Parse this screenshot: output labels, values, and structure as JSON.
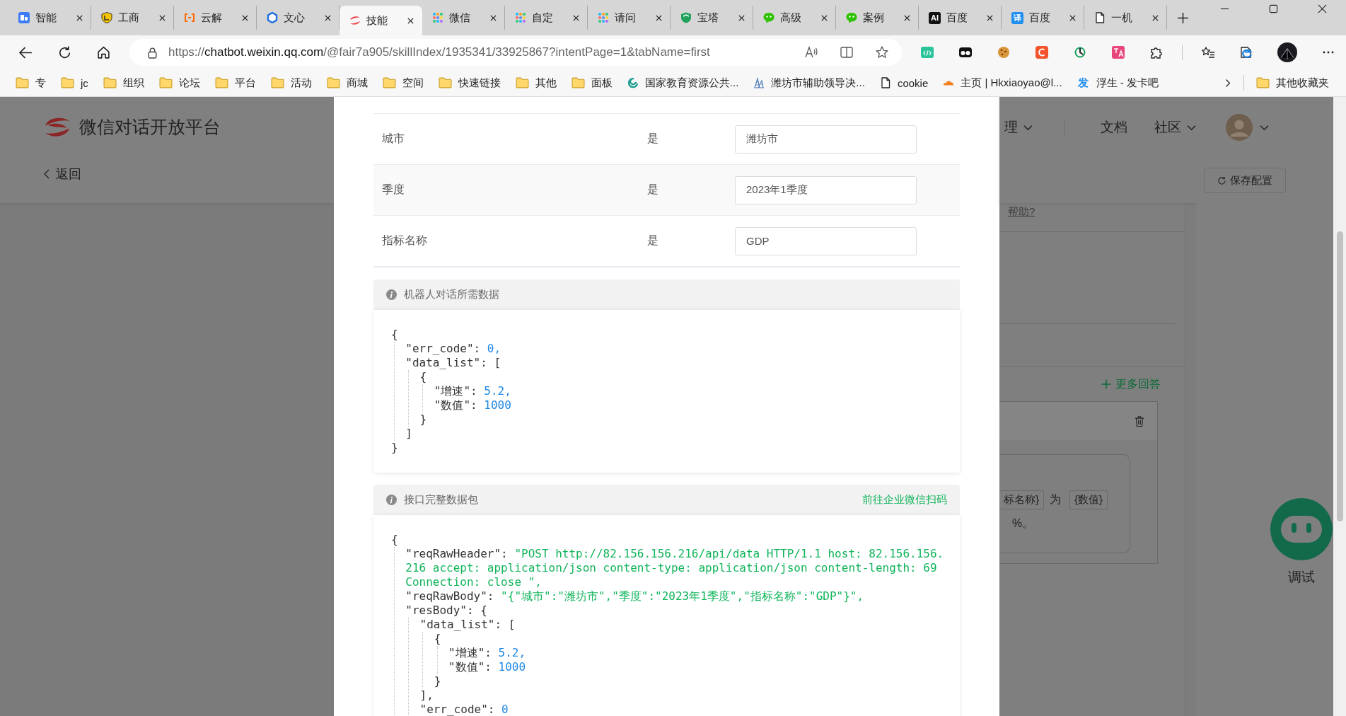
{
  "browser": {
    "tabs": [
      {
        "title": "智能",
        "selected": false
      },
      {
        "title": "工商",
        "selected": false
      },
      {
        "title": "云解",
        "selected": false
      },
      {
        "title": "文心",
        "selected": false
      },
      {
        "title": "技能",
        "selected": true
      },
      {
        "title": "微信",
        "selected": false
      },
      {
        "title": "自定",
        "selected": false
      },
      {
        "title": "请问",
        "selected": false
      },
      {
        "title": "宝塔",
        "selected": false
      },
      {
        "title": "高级",
        "selected": false
      },
      {
        "title": "案例",
        "selected": false
      },
      {
        "title": "百度",
        "badge": "AI",
        "selected": false
      },
      {
        "title": "百度",
        "badge": "译",
        "selected": false
      },
      {
        "title": "一机",
        "selected": false
      }
    ],
    "address": {
      "scheme": "https://",
      "host": "chatbot.weixin.qq.com",
      "path": "/@fair7a905/skillIndex/1935341/33925867?intentPage=1&tabName=first"
    },
    "bookmarks": [
      {
        "label": "专"
      },
      {
        "label": "jc"
      },
      {
        "label": "组织"
      },
      {
        "label": "论坛"
      },
      {
        "label": "平台"
      },
      {
        "label": "活动"
      },
      {
        "label": "商城"
      },
      {
        "label": "空间"
      },
      {
        "label": "快速链接"
      },
      {
        "label": "其他"
      },
      {
        "label": "面板"
      },
      {
        "label": "国家教育资源公共..."
      },
      {
        "label": "潍坊市辅助领导决..."
      },
      {
        "label": "cookie"
      },
      {
        "label": "主页 | Hkxiaoyao@l..."
      },
      {
        "label": "浮生 - 发卡吧",
        "badge": "发"
      }
    ],
    "other_bookmarks": "其他收藏夹"
  },
  "page": {
    "brand": "微信对话开放平台",
    "back": "返回",
    "nav": [
      {
        "label": "理",
        "dropdown": true
      },
      {
        "label": "文档",
        "dropdown": false
      },
      {
        "label": "社区",
        "dropdown": true
      }
    ],
    "save_button": "保存配置",
    "help_link": "帮助?",
    "more_answers": "更多回答",
    "answer_lines": [
      [
        {
          "kind": "chip",
          "text": "标名称}"
        },
        {
          "kind": "plain",
          "text": "为"
        },
        {
          "kind": "chip",
          "text": "{数值}"
        }
      ],
      [
        {
          "kind": "plain",
          "text": "%。"
        }
      ]
    ],
    "debug": "调试"
  },
  "dialog": {
    "slots": [
      {
        "name": "城市",
        "required": "是",
        "value": "潍坊市"
      },
      {
        "name": "季度",
        "required": "是",
        "value": "2023年1季度"
      },
      {
        "name": "指标名称",
        "required": "是",
        "value": "GDP"
      }
    ],
    "sections": [
      {
        "title": "机器人对话所需数据",
        "code": [
          {
            "tokens": [
              {
                "kind": "punct",
                "text": "{"
              }
            ],
            "children": [
              {
                "tokens": [
                  {
                    "kind": "key",
                    "text": "\"err_code\""
                  },
                  {
                    "kind": "punct",
                    "text": ": "
                  },
                  {
                    "kind": "num",
                    "text": "0,"
                  }
                ]
              },
              {
                "tokens": [
                  {
                    "kind": "key",
                    "text": "\"data_list\""
                  },
                  {
                    "kind": "punct",
                    "text": ": ["
                  }
                ],
                "children": [
                  {
                    "tokens": [
                      {
                        "kind": "punct",
                        "text": "{"
                      }
                    ],
                    "children": [
                      {
                        "tokens": [
                          {
                            "kind": "key",
                            "text": "\"增速\""
                          },
                          {
                            "kind": "punct",
                            "text": ": "
                          },
                          {
                            "kind": "num",
                            "text": "5.2,"
                          }
                        ]
                      },
                      {
                        "tokens": [
                          {
                            "kind": "key",
                            "text": "\"数值\""
                          },
                          {
                            "kind": "punct",
                            "text": ": "
                          },
                          {
                            "kind": "num",
                            "text": "1000"
                          }
                        ]
                      }
                    ]
                  },
                  {
                    "tokens": [
                      {
                        "kind": "punct",
                        "text": "}"
                      }
                    ]
                  }
                ]
              },
              {
                "tokens": [
                  {
                    "kind": "punct",
                    "text": "]"
                  }
                ]
              }
            ]
          },
          {
            "tokens": [
              {
                "kind": "punct",
                "text": "}"
              }
            ]
          }
        ]
      },
      {
        "title": "接口完整数据包",
        "link": "前往企业微信扫码",
        "code": [
          {
            "tokens": [
              {
                "kind": "punct",
                "text": "{"
              }
            ],
            "children": [
              {
                "tokens": [
                  {
                    "kind": "key",
                    "text": "\"reqRawHeader\""
                  },
                  {
                    "kind": "punct",
                    "text": ": "
                  },
                  {
                    "kind": "str",
                    "text": "\"POST http://82.156.156.216/api/data HTTP/1.1 host: 82.156.156.216 accept: application/json content-type: application/json content-length: 69 Connection: close \","
                  }
                ]
              },
              {
                "tokens": [
                  {
                    "kind": "key",
                    "text": "\"reqRawBody\""
                  },
                  {
                    "kind": "punct",
                    "text": ": "
                  },
                  {
                    "kind": "str",
                    "text": "\"{\"城市\":\"潍坊市\",\"季度\":\"2023年1季度\",\"指标名称\":\"GDP\"}\","
                  }
                ]
              },
              {
                "tokens": [
                  {
                    "kind": "key",
                    "text": "\"resBody\""
                  },
                  {
                    "kind": "punct",
                    "text": ": {"
                  }
                ],
                "children": [
                  {
                    "tokens": [
                      {
                        "kind": "key",
                        "text": "\"data_list\""
                      },
                      {
                        "kind": "punct",
                        "text": ": ["
                      }
                    ],
                    "children": [
                      {
                        "tokens": [
                          {
                            "kind": "punct",
                            "text": "{"
                          }
                        ],
                        "children": [
                          {
                            "tokens": [
                              {
                                "kind": "key",
                                "text": "\"增速\""
                              },
                              {
                                "kind": "punct",
                                "text": ": "
                              },
                              {
                                "kind": "num",
                                "text": "5.2,"
                              }
                            ]
                          },
                          {
                            "tokens": [
                              {
                                "kind": "key",
                                "text": "\"数值\""
                              },
                              {
                                "kind": "punct",
                                "text": ": "
                              },
                              {
                                "kind": "num",
                                "text": "1000"
                              }
                            ]
                          }
                        ]
                      },
                      {
                        "tokens": [
                          {
                            "kind": "punct",
                            "text": "}"
                          }
                        ]
                      }
                    ]
                  },
                  {
                    "tokens": [
                      {
                        "kind": "punct",
                        "text": "],"
                      }
                    ]
                  },
                  {
                    "tokens": [
                      {
                        "kind": "key",
                        "text": "\"err_code\""
                      },
                      {
                        "kind": "punct",
                        "text": ": "
                      },
                      {
                        "kind": "num",
                        "text": "0"
                      }
                    ]
                  }
                ]
              }
            ]
          }
        ]
      }
    ]
  }
}
